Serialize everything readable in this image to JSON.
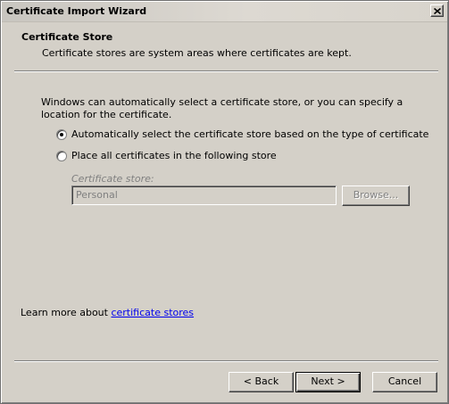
{
  "window": {
    "title": "Certificate Import Wizard"
  },
  "header": {
    "title": "Certificate Store",
    "description": "Certificate stores are system areas where certificates are kept."
  },
  "intro_text": "Windows can automatically select a certificate store, or you can specify a location for the certificate.",
  "options": [
    {
      "label": "Automatically select the certificate store based on the type of certificate",
      "checked": true
    },
    {
      "label": "Place all certificates in the following store",
      "checked": false
    }
  ],
  "store": {
    "label": "Certificate store:",
    "value": "Personal",
    "browse_label": "Browse..."
  },
  "learn_more": {
    "prefix": "Learn more about ",
    "link_text": "certificate stores"
  },
  "buttons": {
    "back": "< Back",
    "next": "Next >",
    "cancel": "Cancel"
  }
}
